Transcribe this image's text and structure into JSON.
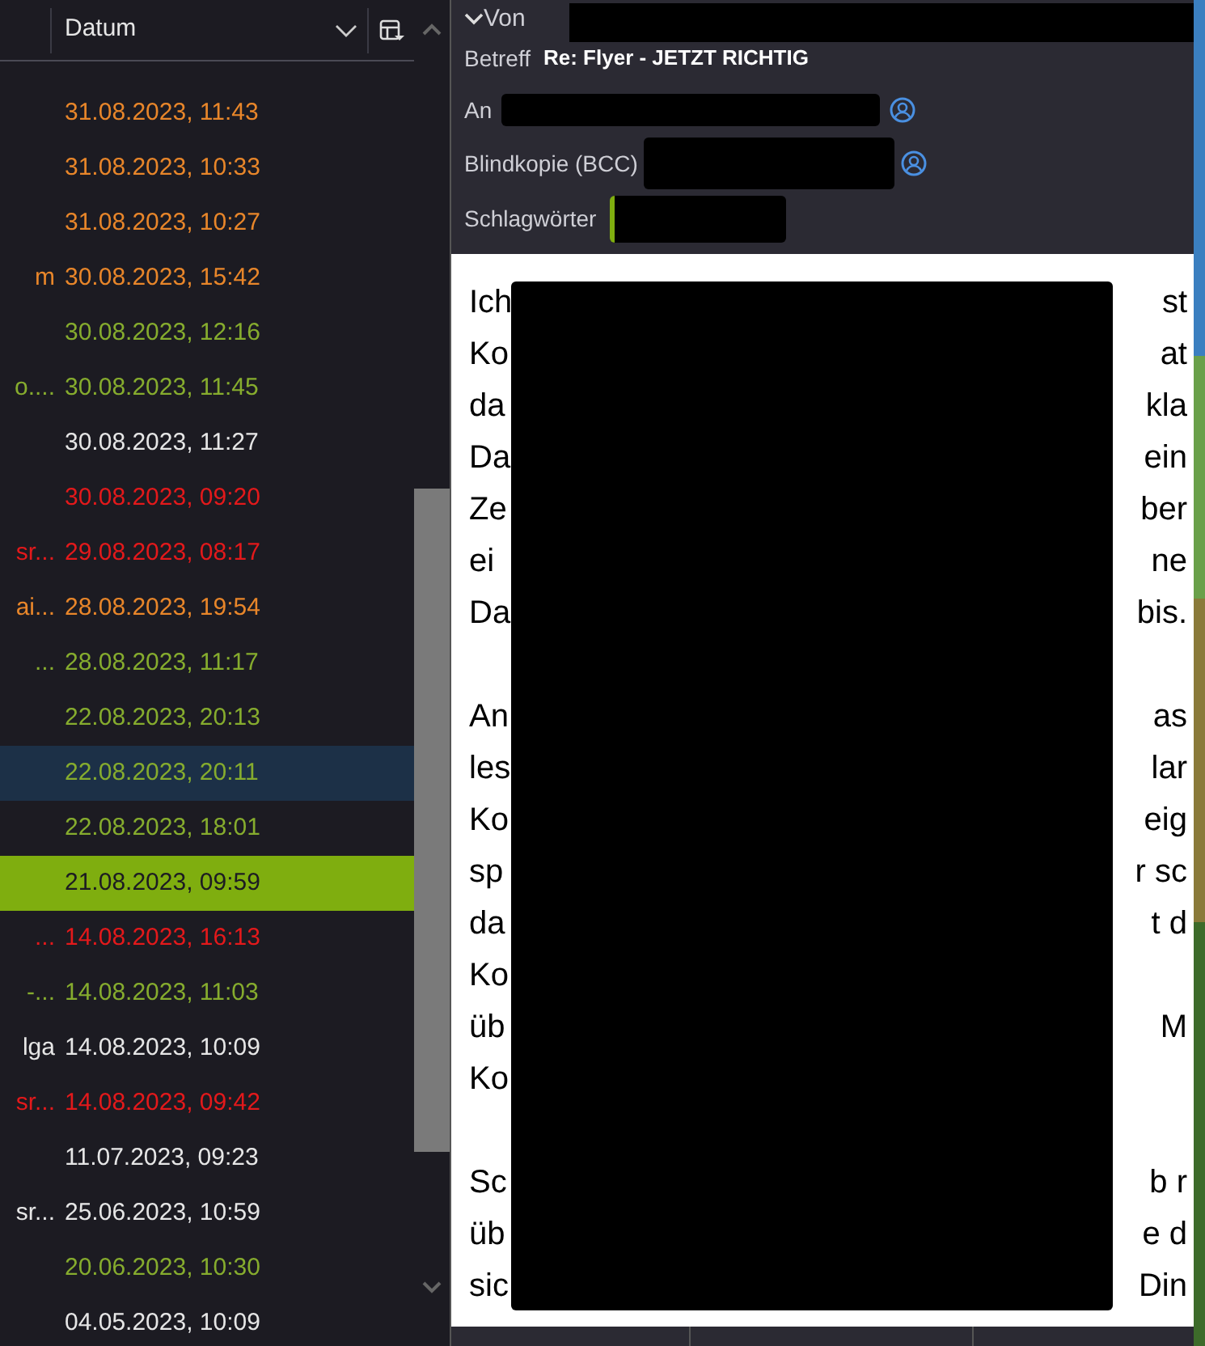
{
  "message_list": {
    "columns": [
      {
        "label": "Datum"
      }
    ],
    "rows": [
      {
        "date": "31.08.2023, 11:43",
        "color": "#e8862a",
        "selected": false,
        "hovered": false
      },
      {
        "date": "31.08.2023, 10:33",
        "color": "#e8862a",
        "selected": false,
        "hovered": false
      },
      {
        "date": "31.08.2023, 10:27",
        "color": "#e8862a",
        "selected": false,
        "hovered": false
      },
      {
        "subject": "m",
        "date": "30.08.2023, 15:42",
        "color": "#e8862a",
        "selected": false,
        "hovered": false
      },
      {
        "date": "30.08.2023, 12:16",
        "color": "#86ac2e",
        "selected": false,
        "hovered": false
      },
      {
        "subject": "o....",
        "date": "30.08.2023, 11:45",
        "color": "#86ac2e",
        "selected": false,
        "hovered": false
      },
      {
        "date": "30.08.2023, 11:27",
        "color": "#e6e6e6",
        "selected": false,
        "hovered": false
      },
      {
        "date": "30.08.2023, 09:20",
        "color": "#e3191b",
        "selected": false,
        "hovered": false
      },
      {
        "subject": "sr...",
        "date": "29.08.2023, 08:17",
        "color": "#e3191b",
        "selected": false,
        "hovered": false
      },
      {
        "subject": "ai...",
        "date": "28.08.2023, 19:54",
        "color": "#e8862a",
        "selected": false,
        "hovered": false
      },
      {
        "subject": "...",
        "date": "28.08.2023, 11:17",
        "color": "#86ac2e",
        "selected": false,
        "hovered": false
      },
      {
        "date": "22.08.2023, 20:13",
        "color": "#86ac2e",
        "selected": false,
        "hovered": false
      },
      {
        "date": "22.08.2023, 20:11",
        "color": "#86ac2e",
        "selected": false,
        "hovered": true
      },
      {
        "date": "22.08.2023, 18:01",
        "color": "#86ac2e",
        "selected": false,
        "hovered": false
      },
      {
        "date": "21.08.2023, 09:59",
        "color": "#1c1b22",
        "selected": true,
        "hovered": false
      },
      {
        "subject": "...",
        "date": "14.08.2023, 16:13",
        "color": "#e3191b",
        "selected": false,
        "hovered": false
      },
      {
        "subject": "-...",
        "date": "14.08.2023, 11:03",
        "color": "#86ac2e",
        "selected": false,
        "hovered": false
      },
      {
        "subject": "lga",
        "date": "14.08.2023, 10:09",
        "color": "#e6e6e6",
        "selected": false,
        "hovered": false
      },
      {
        "subject": "sr...",
        "date": "14.08.2023, 09:42",
        "color": "#e3191b",
        "selected": false,
        "hovered": false
      },
      {
        "date": "11.07.2023, 09:23",
        "color": "#e6e6e6",
        "selected": false,
        "hovered": false
      },
      {
        "subject": "sr...",
        "date": "25.06.2023, 10:59",
        "color": "#e6e6e6",
        "selected": false,
        "hovered": false
      },
      {
        "date": "20.06.2023, 10:30",
        "color": "#86ac2e",
        "selected": false,
        "hovered": false
      },
      {
        "date": "04.05.2023, 10:09",
        "color": "#e6e6e6",
        "selected": false,
        "hovered": false
      }
    ]
  },
  "header": {
    "from_label": "Von",
    "subject_label": "Betreff",
    "subject": "Re: Flyer - JETZT RICHTIG",
    "to_label": "An",
    "bcc_label": "Blindkopie (BCC)",
    "tags_label": "Schlagwörter"
  },
  "body": {
    "paragraphs": [
      [
        {
          "start": "Ich",
          "end": "st"
        },
        {
          "start": "Ko",
          "end": "at"
        },
        {
          "start": "da",
          "end": "kla"
        },
        {
          "start": "Da",
          "end": "ein"
        },
        {
          "start": "Ze",
          "end": "ber"
        },
        {
          "start": "ei",
          "end": "ne"
        },
        {
          "start": "Da",
          "end": "bis."
        }
      ],
      [
        {
          "start": "An",
          "end": "as"
        },
        {
          "start": "les",
          "end": "lar"
        },
        {
          "start": "Ko",
          "end": "eig"
        },
        {
          "start": "sp",
          "end": "r sc"
        },
        {
          "start": "da",
          "end": "t d"
        },
        {
          "start": "Ko"
        },
        {
          "start": "üb",
          "end": "M"
        },
        {
          "start": "Ko"
        }
      ],
      [
        {
          "start": "Sc",
          "end": "b r"
        },
        {
          "start": "üb",
          "end": "e d"
        },
        {
          "start": "sic",
          "end": "Din"
        }
      ]
    ]
  }
}
